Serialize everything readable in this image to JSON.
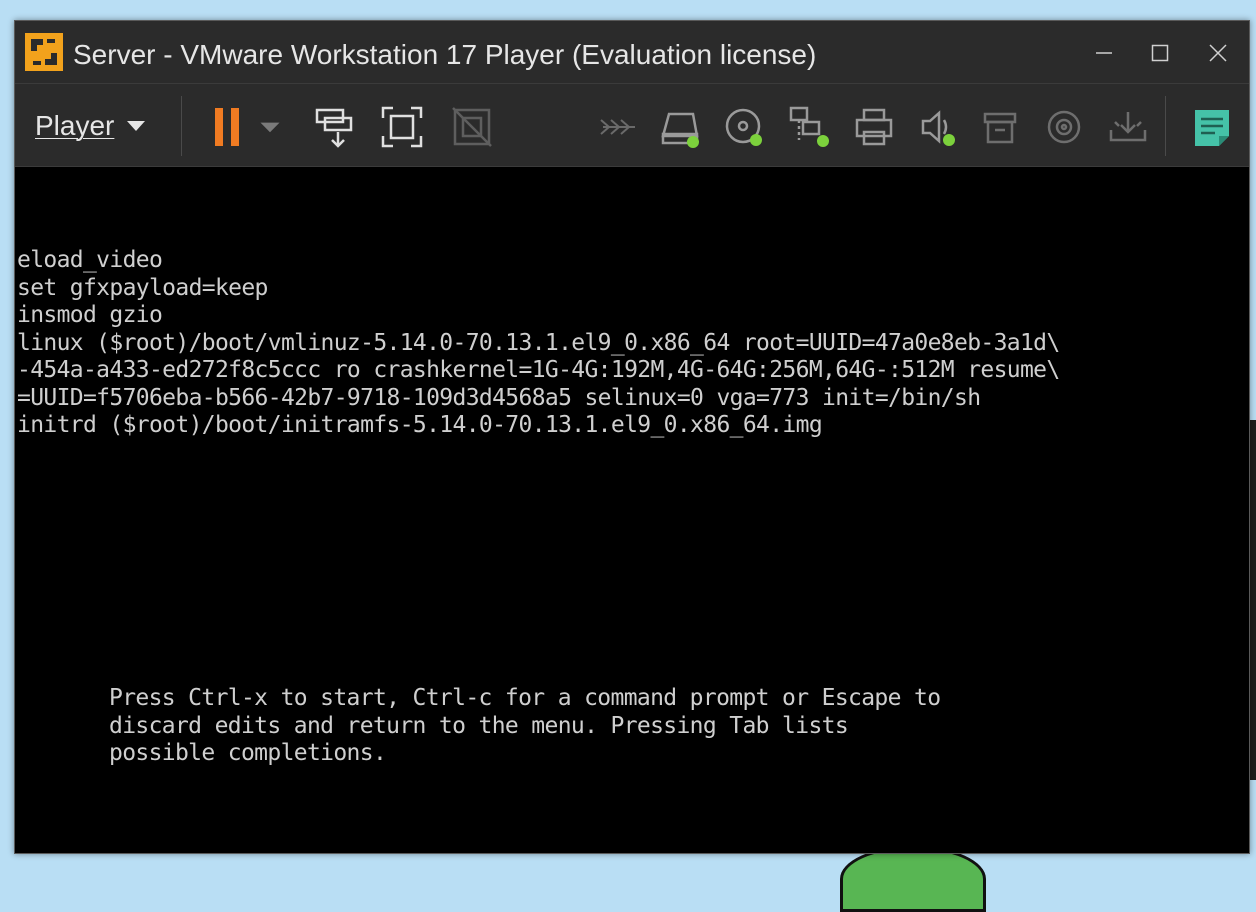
{
  "window": {
    "title": "Server - VMware Workstation 17 Player (Evaluation license)",
    "controls": {
      "minimize": "minimize-icon",
      "maximize": "maximize-icon",
      "close": "close-icon"
    }
  },
  "toolbar": {
    "player_menu_label": "Player",
    "icons": [
      "pause-icon",
      "send-ctrl-alt-del-icon",
      "fullscreen-icon",
      "unity-icon",
      "connect-icon",
      "hard-disk-icon",
      "cd-dvd-icon",
      "network-adapter-icon",
      "printer-icon",
      "sound-card-icon",
      "usb-icon",
      "camera-icon",
      "install-tools-icon",
      "notes-icon"
    ]
  },
  "console": {
    "lines": [
      "eload_video",
      "set gfxpayload=keep",
      "insmod gzio",
      "linux ($root)/boot/vmlinuz-5.14.0-70.13.1.el9_0.x86_64 root=UUID=47a0e8eb-3a1d\\",
      "-454a-a433-ed272f8c5ccc ro crashkernel=1G-4G:192M,4G-64G:256M,64G-:512M resume\\",
      "=UUID=f5706eba-b566-42b7-9718-109d3d4568a5 selinux=0 vga=773 init=/bin/sh",
      "initrd ($root)/boot/initramfs-5.14.0-70.13.1.el9_0.x86_64.img"
    ],
    "help": [
      "Press Ctrl-x to start, Ctrl-c for a command prompt or Escape to",
      "discard edits and return to the menu. Pressing Tab lists",
      "possible completions."
    ]
  },
  "colors": {
    "titlebar_bg": "#2b2b2b",
    "accent_orange": "#f07b22",
    "device_green": "#7cd13c",
    "notes_teal": "#45c2a8",
    "console_text": "#cfcfcf"
  }
}
